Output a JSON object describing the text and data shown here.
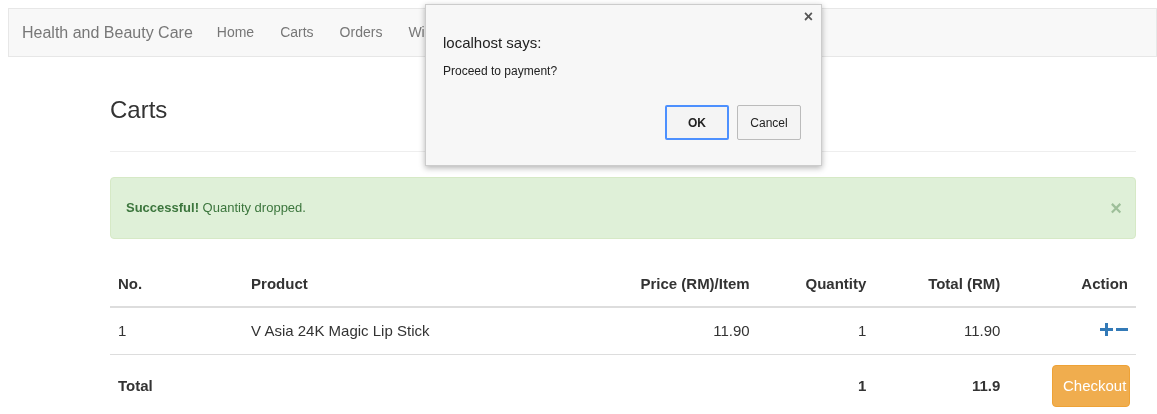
{
  "navbar": {
    "brand": "Health and Beauty Care",
    "items": [
      "Home",
      "Carts",
      "Orders",
      "Wi"
    ]
  },
  "page_title": "Carts",
  "alert": {
    "strong": "Successful!",
    "message": "Quantity dropped.",
    "close": "×"
  },
  "table": {
    "columns": [
      "No.",
      "Product",
      "Price (RM)/Item",
      "Quantity",
      "Total (RM)",
      "Action"
    ],
    "rows": [
      {
        "no": "1",
        "product": "V Asia 24K Magic Lip Stick",
        "price": "11.90",
        "quantity": "1",
        "total": "11.90"
      }
    ],
    "footer": {
      "label": "Total",
      "quantity": "1",
      "total": "11.9",
      "button": "Checkout"
    }
  },
  "dialog": {
    "title": "localhost says:",
    "message": "Proceed to payment?",
    "close": "×",
    "buttons": [
      {
        "label": "OK",
        "kind": "primary"
      },
      {
        "label": "Cancel",
        "kind": "secondary"
      }
    ]
  }
}
